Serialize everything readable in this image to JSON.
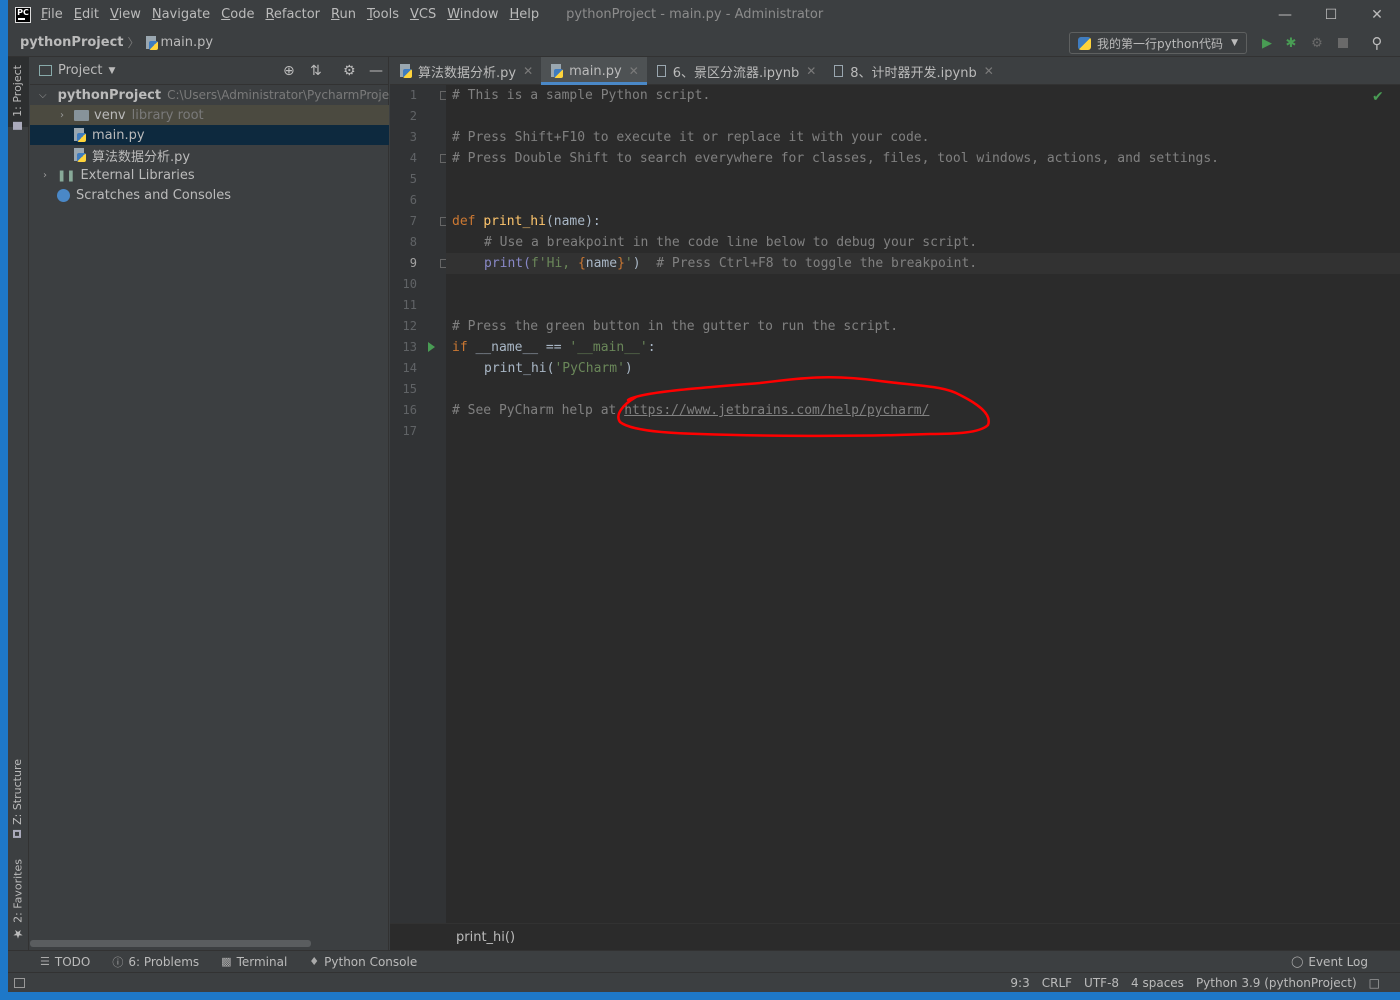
{
  "titlebar": {
    "menu": [
      "File",
      "Edit",
      "View",
      "Navigate",
      "Code",
      "Refactor",
      "Run",
      "Tools",
      "VCS",
      "Window",
      "Help"
    ],
    "title": "pythonProject - main.py - Administrator"
  },
  "navbar": {
    "project": "pythonProject",
    "file": "main.py",
    "run_config": "我的第一行python代码"
  },
  "left_strip": {
    "project_tab": "1: Project",
    "structure_tab": "Z: Structure",
    "favorites_tab": "2: Favorites"
  },
  "project_panel": {
    "title": "Project",
    "root": {
      "name": "pythonProject",
      "path": "C:\\Users\\Administrator\\PycharmProjects"
    },
    "venv": {
      "name": "venv",
      "note": "library root"
    },
    "files": [
      "main.py",
      "算法数据分析.py"
    ],
    "external": "External Libraries",
    "scratches": "Scratches and Consoles"
  },
  "editor": {
    "tabs": [
      {
        "label": "算法数据分析.py"
      },
      {
        "label": "main.py"
      },
      {
        "label": "6、景区分流器.ipynb"
      },
      {
        "label": "8、计时器开发.ipynb"
      }
    ],
    "line_numbers": [
      "1",
      "2",
      "3",
      "4",
      "5",
      "6",
      "7",
      "8",
      "9",
      "10",
      "11",
      "12",
      "13",
      "14",
      "15",
      "16",
      "17"
    ],
    "current_line": "9",
    "code": {
      "l1": "# This is a sample Python script.",
      "l3": "# Press Shift+F10 to execute it or replace it with your code.",
      "l4": "# Press Double Shift to search everywhere for classes, files, tool windows, actions, and settings.",
      "l7_kw": "def ",
      "l7_fn": "print_hi",
      "l7_rest": "(name):",
      "l8": "# Use a breakpoint in the code line below to debug your script.",
      "l9_call": "print(",
      "l9_str1": "f'Hi, ",
      "l9_b1": "{",
      "l9_var": "name",
      "l9_b2": "}",
      "l9_str2": "'",
      "l9_close": ")  ",
      "l9_com": "# Press Ctrl+F8 to toggle the breakpoint.",
      "l12": "# Press the green button in the gutter to run the script.",
      "l13_kw": "if ",
      "l13_mid": "__name__ == ",
      "l13_str": "'__main__'",
      "l13_end": ":",
      "l14_call": "print_hi(",
      "l14_str": "'PyCharm'",
      "l14_end": ")",
      "l16_com": "# See PyCharm help at ",
      "l16_link": "https://www.jetbrains.com/help/pycharm/"
    },
    "breadcrumb": "print_hi()"
  },
  "toolwindows": {
    "todo": "TODO",
    "problems": "6: Problems",
    "terminal": "Terminal",
    "python_console": "Python Console",
    "event_log": "Event Log"
  },
  "status": {
    "position": "9:3",
    "line_sep": "CRLF",
    "encoding": "UTF-8",
    "indent": "4 spaces",
    "interpreter": "Python 3.9 (pythonProject)"
  },
  "colors": {
    "annotation": "#ff0000",
    "accent": "#4a88c7"
  }
}
